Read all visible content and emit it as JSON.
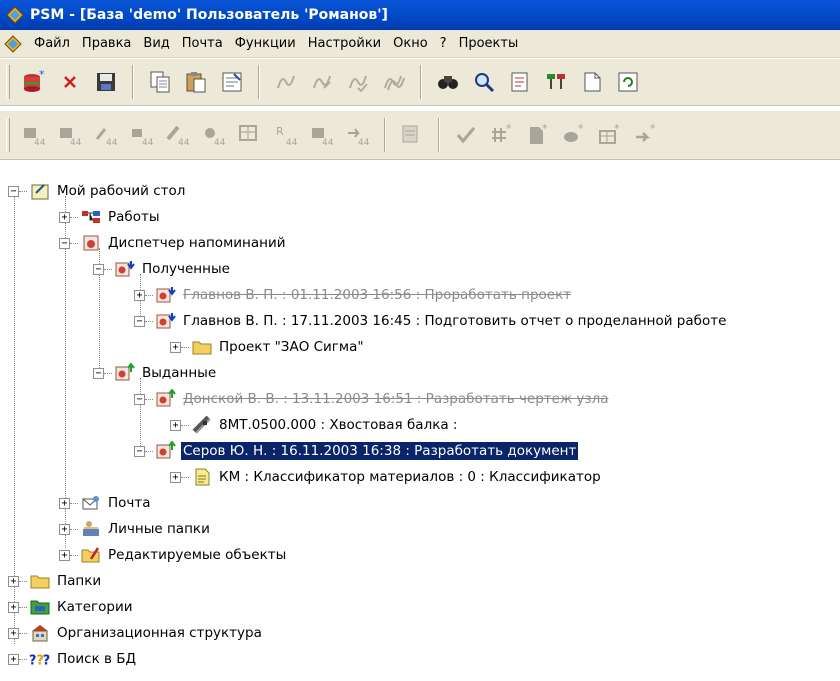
{
  "title": "PSM - [База 'demo' Пользователь 'Романов']",
  "menu": [
    {
      "label": "Файл"
    },
    {
      "label": "Правка"
    },
    {
      "label": "Вид"
    },
    {
      "label": "Почта"
    },
    {
      "label": "Функции"
    },
    {
      "label": "Настройки"
    },
    {
      "label": "Окно"
    },
    {
      "label": "?"
    },
    {
      "label": "Проекты"
    }
  ],
  "toolbar1_icons": [
    "new-db-icon",
    "delete-icon",
    "save-icon",
    "copy-icon",
    "paste-icon",
    "properties-icon",
    "route-icon",
    "route-edit-icon",
    "route-check-icon",
    "route-multi-icon",
    "find-icon",
    "search-icon",
    "notes-icon",
    "tree-icon",
    "document-icon",
    "refresh-icon"
  ],
  "toolbar2_icons": [
    "find-a-icon",
    "find-b-icon",
    "find-c-icon",
    "find-d-icon",
    "find-e-icon",
    "find-f-icon",
    "find-g-icon",
    "find-h-icon",
    "find-i-icon",
    "find-j-icon",
    "find-k-icon",
    "check-icon",
    "new-object-icon",
    "new-doc-icon",
    "new-item-icon",
    "new-table-icon",
    "new-link-icon"
  ],
  "tree": {
    "desktop": "Мой рабочий стол",
    "works": "Работы",
    "reminders": "Диспетчер напоминаний",
    "received": "Полученные",
    "r1": "Главнов В. П. : 01.11.2003 16:56 : Проработать проект",
    "r2": "Главнов В. П. : 17.11.2003 16:45 : Подготовить отчет о проделанной работе",
    "r2_child": "Проект \"ЗАО Сигма\"",
    "issued": "Выданные",
    "i1": "Донской В. В. : 13.11.2003 16:51 : Разработать чертеж узла",
    "i1_child": "8МТ.0500.000 : Хвостовая балка :",
    "i2": "Серов Ю. Н. : 16.11.2003 16:38 : Разработать документ",
    "i2_child": "КМ : Классификатор материалов : 0 : Классификатор",
    "mail": "Почта",
    "personal": "Личные папки",
    "editable": "Редактируемые объекты",
    "folders": "Папки",
    "categories": "Категории",
    "org": "Организационная структура",
    "search": "Поиск в БД"
  }
}
